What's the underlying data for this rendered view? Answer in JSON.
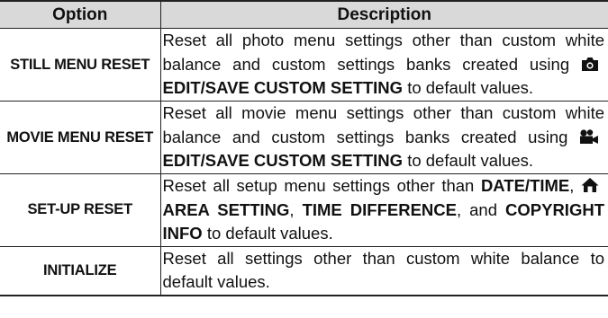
{
  "table": {
    "headers": {
      "option": "Option",
      "description": "Description"
    },
    "rows": [
      {
        "option": "STILL MENU RESET",
        "desc": {
          "before": "Reset all photo menu settings other than custom white balance and custom settings banks created using ",
          "icon": "camera-icon",
          "keyword": "EDIT/SAVE CUSTOM SETTING",
          "after": " to default values."
        }
      },
      {
        "option": "MOVIE MENU RESET",
        "desc": {
          "before": "Reset all movie menu settings other than custom white balance and custom settings banks created using ",
          "icon": "movie-camera-icon",
          "keyword": "EDIT/SAVE CUSTOM SETTING",
          "after": " to default values."
        }
      },
      {
        "option": "SET-UP RESET",
        "desc": {
          "before": "Reset all setup menu settings other than ",
          "kw1": "DATE/TIME",
          "sep1": ", ",
          "icon": "home-icon",
          "kw2": "AREA SETTING",
          "sep2": ", ",
          "kw3": "TIME DIFFERENCE",
          "sep3": ", and ",
          "kw4": "COPYRIGHT INFO",
          "after": " to default values."
        }
      },
      {
        "option": "INITIALIZE",
        "desc": {
          "text": "Reset all settings other than custom white balance to default values."
        }
      }
    ]
  }
}
